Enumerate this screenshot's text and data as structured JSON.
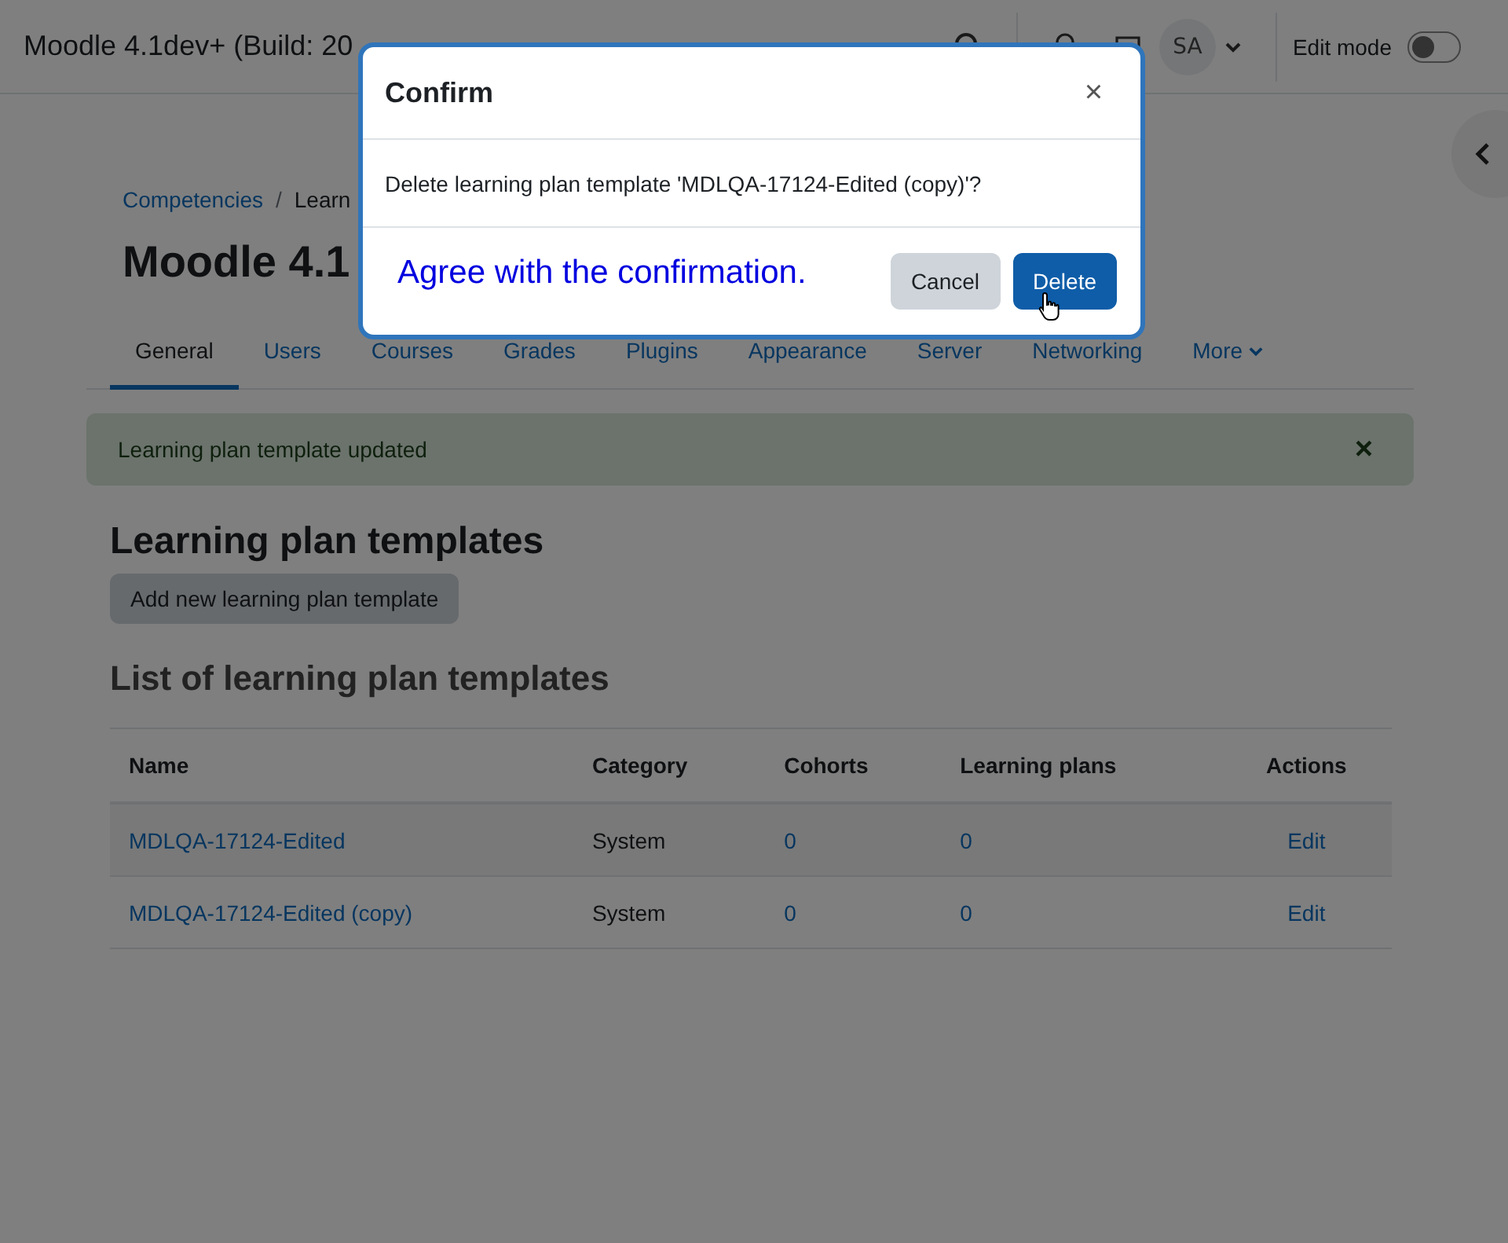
{
  "header": {
    "site_name": "Moodle 4.1dev+ (Build: 20",
    "avatar": "SA",
    "edit_mode": {
      "label": "Edit mode",
      "on": false
    }
  },
  "breadcrumb": [
    "Competencies",
    "Learn"
  ],
  "breadcrumb_separator": "/",
  "page_title": "Moodle 4.1",
  "tabs": [
    {
      "label": "General",
      "selected": true,
      "more": false
    },
    {
      "label": "Users",
      "selected": false,
      "more": false
    },
    {
      "label": "Courses",
      "selected": false,
      "more": false
    },
    {
      "label": "Grades",
      "selected": false,
      "more": false
    },
    {
      "label": "Plugins",
      "selected": false,
      "more": false
    },
    {
      "label": "Appearance",
      "selected": false,
      "more": false
    },
    {
      "label": "Server",
      "selected": false,
      "more": false
    },
    {
      "label": "Networking",
      "selected": false,
      "more": false
    },
    {
      "label": "More",
      "selected": false,
      "more": true
    }
  ],
  "alert": {
    "message": "Learning plan template updated",
    "close": "×"
  },
  "heading": "Learning plan templates",
  "add_button": "Add new learning plan template",
  "list_heading": "List of learning plan templates",
  "table": {
    "columns": [
      "Name",
      "Category",
      "Cohorts",
      "Learning plans",
      "Actions"
    ],
    "rows": [
      {
        "name": "MDLQA-17124-Edited",
        "category": "System",
        "cohorts": "0",
        "plans": "0",
        "action": "Edit"
      },
      {
        "name": "MDLQA-17124-Edited (copy)",
        "category": "System",
        "cohorts": "0",
        "plans": "0",
        "action": "Edit"
      }
    ]
  },
  "dialog": {
    "title": "Confirm",
    "close": "×",
    "message": "Delete learning plan template 'MDLQA-17124-Edited (copy)'?",
    "instruction": "Agree with the confirmation.",
    "buttons": [
      {
        "label": "Cancel",
        "kind": "secondary"
      },
      {
        "label": "Delete",
        "kind": "primary"
      }
    ]
  }
}
